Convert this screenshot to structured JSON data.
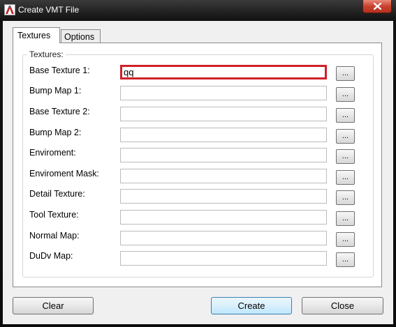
{
  "window": {
    "title": "Create VMT File"
  },
  "tabs": [
    {
      "label": "Textures"
    },
    {
      "label": "Options"
    }
  ],
  "group": {
    "title": "Textures:"
  },
  "rows": [
    {
      "label": "Base Texture 1:",
      "value": ""
    },
    {
      "label": "Bump Map 1:",
      "value": ""
    },
    {
      "label": "Base Texture 2:",
      "value": ""
    },
    {
      "label": "Bump Map 2:",
      "value": ""
    },
    {
      "label": "Enviroment:",
      "value": ""
    },
    {
      "label": "Enviroment Mask:",
      "value": ""
    },
    {
      "label": "Detail Texture:",
      "value": ""
    },
    {
      "label": "Tool Texture:",
      "value": ""
    },
    {
      "label": "Normal Map:",
      "value": ""
    },
    {
      "label": "DuDv Map:",
      "value": ""
    }
  ],
  "focused_input_value": "qq",
  "browse_label": "...",
  "buttons": {
    "clear": "Clear",
    "create": "Create",
    "close": "Close"
  },
  "colors": {
    "focus_border": "#d0202a",
    "close_button": "#c8432f"
  },
  "icons": {
    "app": "app-icon",
    "close": "close-icon"
  }
}
